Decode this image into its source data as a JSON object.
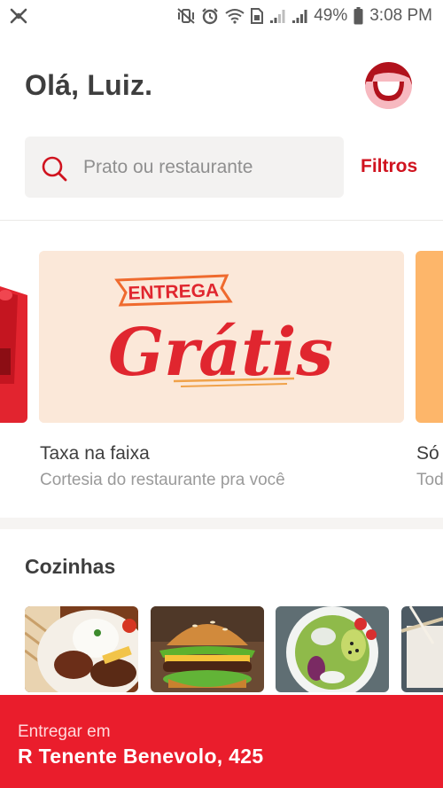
{
  "status_bar": {
    "battery_percent": "49%",
    "time": "3:08 PM"
  },
  "header": {
    "greeting": "Olá, Luiz."
  },
  "search": {
    "placeholder": "Prato ou restaurante",
    "filters_label": "Filtros"
  },
  "promo_banner": {
    "banner_word_small": "ENTREGA",
    "banner_word_large": "Grátis",
    "title": "Taxa na faixa",
    "subtitle": "Cortesia do restaurante pra você",
    "next_title": "Só",
    "next_subtitle": "Tod"
  },
  "cuisines": {
    "title": "Cozinhas",
    "items": [
      {
        "name": "plate-rice-beans"
      },
      {
        "name": "burger"
      },
      {
        "name": "salad-bowl"
      },
      {
        "name": "japanese"
      }
    ]
  },
  "delivery": {
    "label": "Entregar em",
    "address": "R Tenente Benevolo, 425"
  },
  "colors": {
    "brand_red": "#ea1d2c",
    "accent_red": "#d0131f",
    "banner_bg": "#fbe8d9",
    "avatar_bg": "#f7b9c0"
  }
}
